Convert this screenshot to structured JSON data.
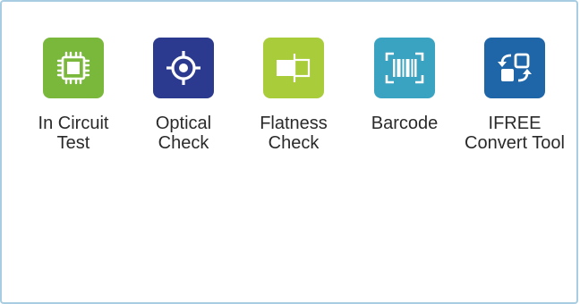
{
  "apps": [
    {
      "id": "in-circuit-test",
      "icon": "circuit-chip-icon",
      "color": "#7ab83c",
      "label_lines": [
        "In Circuit",
        "Test"
      ]
    },
    {
      "id": "optical-check",
      "icon": "crosshair-target-icon",
      "color": "#2b3a8e",
      "label_lines": [
        "Optical",
        "Check"
      ]
    },
    {
      "id": "flatness-check",
      "icon": "flatness-gauge-icon",
      "color": "#a9cc3a",
      "label_lines": [
        "Flatness",
        "Check"
      ]
    },
    {
      "id": "barcode",
      "icon": "barcode-scan-icon",
      "color": "#3aa3c2",
      "label_lines": [
        "Barcode"
      ]
    },
    {
      "id": "ifree-convert-tool",
      "icon": "convert-arrows-icon",
      "color": "#1f66a8",
      "label_lines": [
        "IFREE",
        "Convert Tool"
      ]
    }
  ]
}
